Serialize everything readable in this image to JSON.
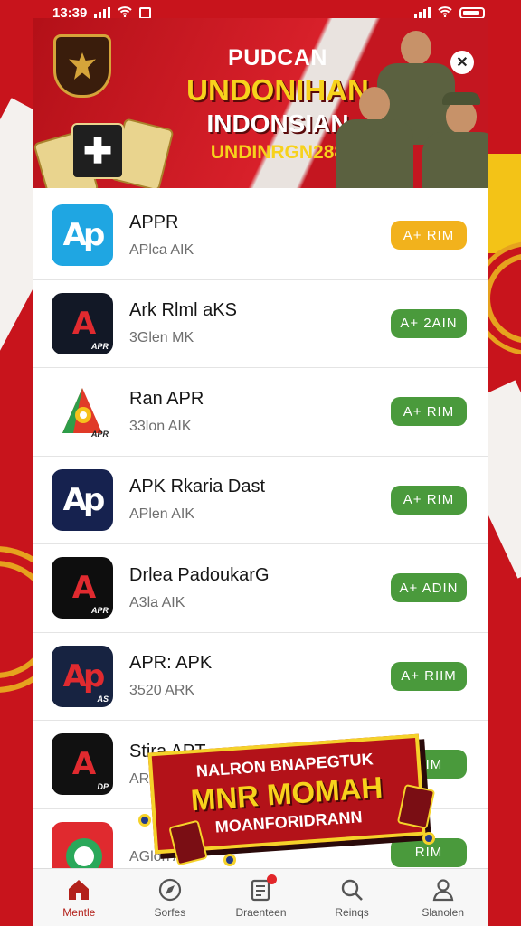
{
  "status_bar": {
    "time": "13:39"
  },
  "banner": {
    "line1": "PUDCAN",
    "line2": "UNDONIHAN",
    "line3": "INDONSIAN",
    "line4": "UNDINRGN288"
  },
  "apps": [
    {
      "name": "APPR",
      "sub": "APlca AIK",
      "button": "A+ RIM",
      "button_color": "#f2b21c",
      "icon_bg": "#1fa6e2",
      "icon_text": "Ap",
      "icon_tag": ""
    },
    {
      "name": "Ark Rlml aKS",
      "sub": "3Glen MK",
      "button": "A+ 2AIN",
      "button_color": "#4a9a3c",
      "icon_bg": "#121826",
      "icon_text": "A",
      "icon_tag": "APR"
    },
    {
      "name": "Ran APR",
      "sub": "33lon AIK",
      "button": "A+ RIM",
      "button_color": "#4a9a3c",
      "icon_bg": "#ffffff",
      "icon_text": "",
      "icon_tag": "APR"
    },
    {
      "name": "APK Rkaria Dast",
      "sub": "APlen AIK",
      "button": "A+ RIM",
      "button_color": "#4a9a3c",
      "icon_bg": "#16224f",
      "icon_text": "Ap",
      "icon_tag": ""
    },
    {
      "name": "Drlea PadoukarG",
      "sub": "A3la AIK",
      "button": "A+ ADIN",
      "button_color": "#4a9a3c",
      "icon_bg": "#0e0e0e",
      "icon_text": "A",
      "icon_tag": "APR"
    },
    {
      "name": "APR: APK",
      "sub": "3520 ARK",
      "button": "A+ RIIM",
      "button_color": "#4a9a3c",
      "icon_bg": "#172341",
      "icon_text": "Ap",
      "icon_tag": "AS"
    },
    {
      "name": "Stira APT",
      "sub": "ARK",
      "button": "RIM",
      "button_color": "#4a9a3c",
      "icon_bg": "#111111",
      "icon_text": "A",
      "icon_tag": "DP"
    },
    {
      "name": "",
      "sub": "AGlon AIK",
      "button": "RIM",
      "button_color": "#4a9a3c",
      "icon_bg": "#e02a2f",
      "icon_text": "",
      "icon_tag": ""
    }
  ],
  "promo": {
    "line1": "NALRON BNAPEGTUK",
    "line2": "MNR MOMAH",
    "line3": "MOANFORIDRANN"
  },
  "nav": [
    {
      "label": "Mentle",
      "icon": "home-icon",
      "active": true
    },
    {
      "label": "Sorfes",
      "icon": "compass-icon",
      "active": false
    },
    {
      "label": "Draenteen",
      "icon": "document-icon",
      "active": false
    },
    {
      "label": "Reinqs",
      "icon": "search-icon",
      "active": false
    },
    {
      "label": "Slanolen",
      "icon": "profile-icon",
      "active": false
    }
  ]
}
